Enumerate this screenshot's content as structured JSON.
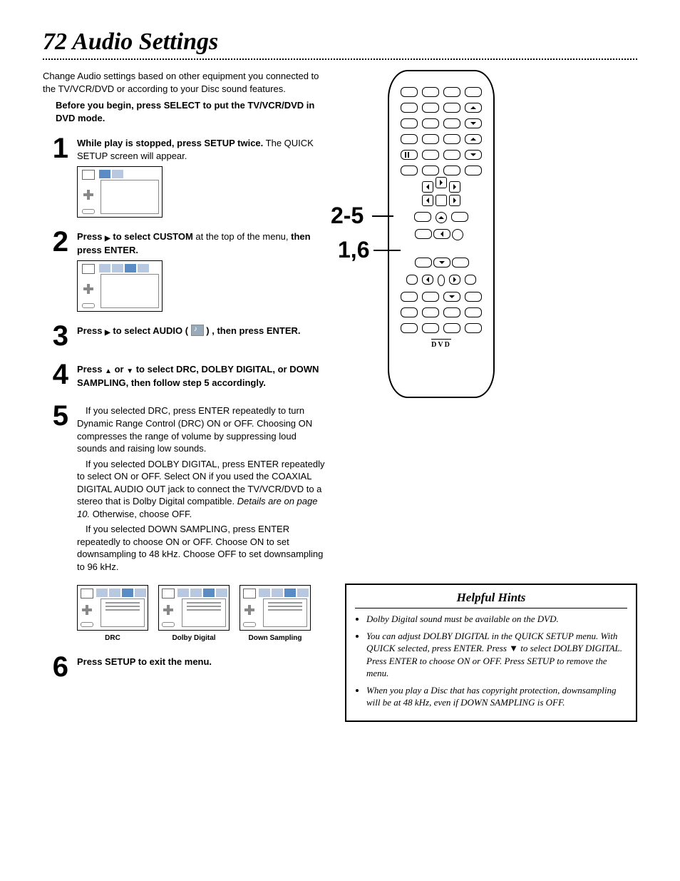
{
  "page_number": "72",
  "page_title": "Audio Settings",
  "intro": "Change Audio settings based on other equipment you connected to the TV/VCR/DVD or according to your Disc sound features.",
  "intro_bold": "Before you begin, press SELECT to put the TV/VCR/DVD in DVD mode.",
  "steps": {
    "s1": {
      "bold": "While play is stopped, press SETUP twice.",
      "rest": " The QUICK SETUP screen will appear."
    },
    "s2": {
      "a": "Press ",
      "b1": " to select CUSTOM",
      "rest": " at the top of the menu, ",
      "b2": "then press ENTER."
    },
    "s3": {
      "a": "Press ",
      "b1": " to select AUDIO ( ",
      "b2": " ) , then press ENTER."
    },
    "s4": {
      "a": "Press ",
      "mid": " or ",
      "b": " to select DRC, DOLBY DIGITAL, or DOWN SAMPLING, then follow step 5 accordingly."
    },
    "s5": {
      "p1": "If you selected DRC, press ENTER repeatedly to turn Dynamic Range Control (DRC) ON or OFF. Choosing ON compresses the range of volume by suppressing loud sounds and raising low sounds.",
      "p2a": "If you selected DOLBY DIGITAL, press ENTER repeatedly to select ON or OFF. Select ON if you used the COAXIAL DIGITAL AUDIO OUT jack to connect the TV/VCR/DVD to a stereo that is Dolby Digital compatible. ",
      "p2i": "Details are on page 10.",
      "p2b": " Otherwise, choose OFF.",
      "p3": "If you selected DOWN SAMPLING, press ENTER repeatedly to choose ON or OFF. Choose ON to set downsampling to 48 kHz. Choose OFF to set downsampling to 96 kHz."
    },
    "s6": {
      "text": "Press SETUP to exit the menu."
    },
    "captions": {
      "c1": "DRC",
      "c2": "Dolby Digital",
      "c3": "Down Sampling"
    }
  },
  "callouts": {
    "a": "2-5",
    "b": "1,6"
  },
  "hints": {
    "title": "Helpful Hints",
    "items": [
      "Dolby Digital sound must be available on the DVD.",
      "You can adjust DOLBY DIGITAL in the QUICK SETUP menu. With QUICK selected, press ENTER. Press ▼ to select DOLBY DIGITAL. Press ENTER to choose ON or OFF. Press SETUP to remove the menu.",
      "When you play a Disc that has copyright protection, downsampling will be at 48 kHz, even if DOWN SAMPLING is OFF."
    ]
  }
}
